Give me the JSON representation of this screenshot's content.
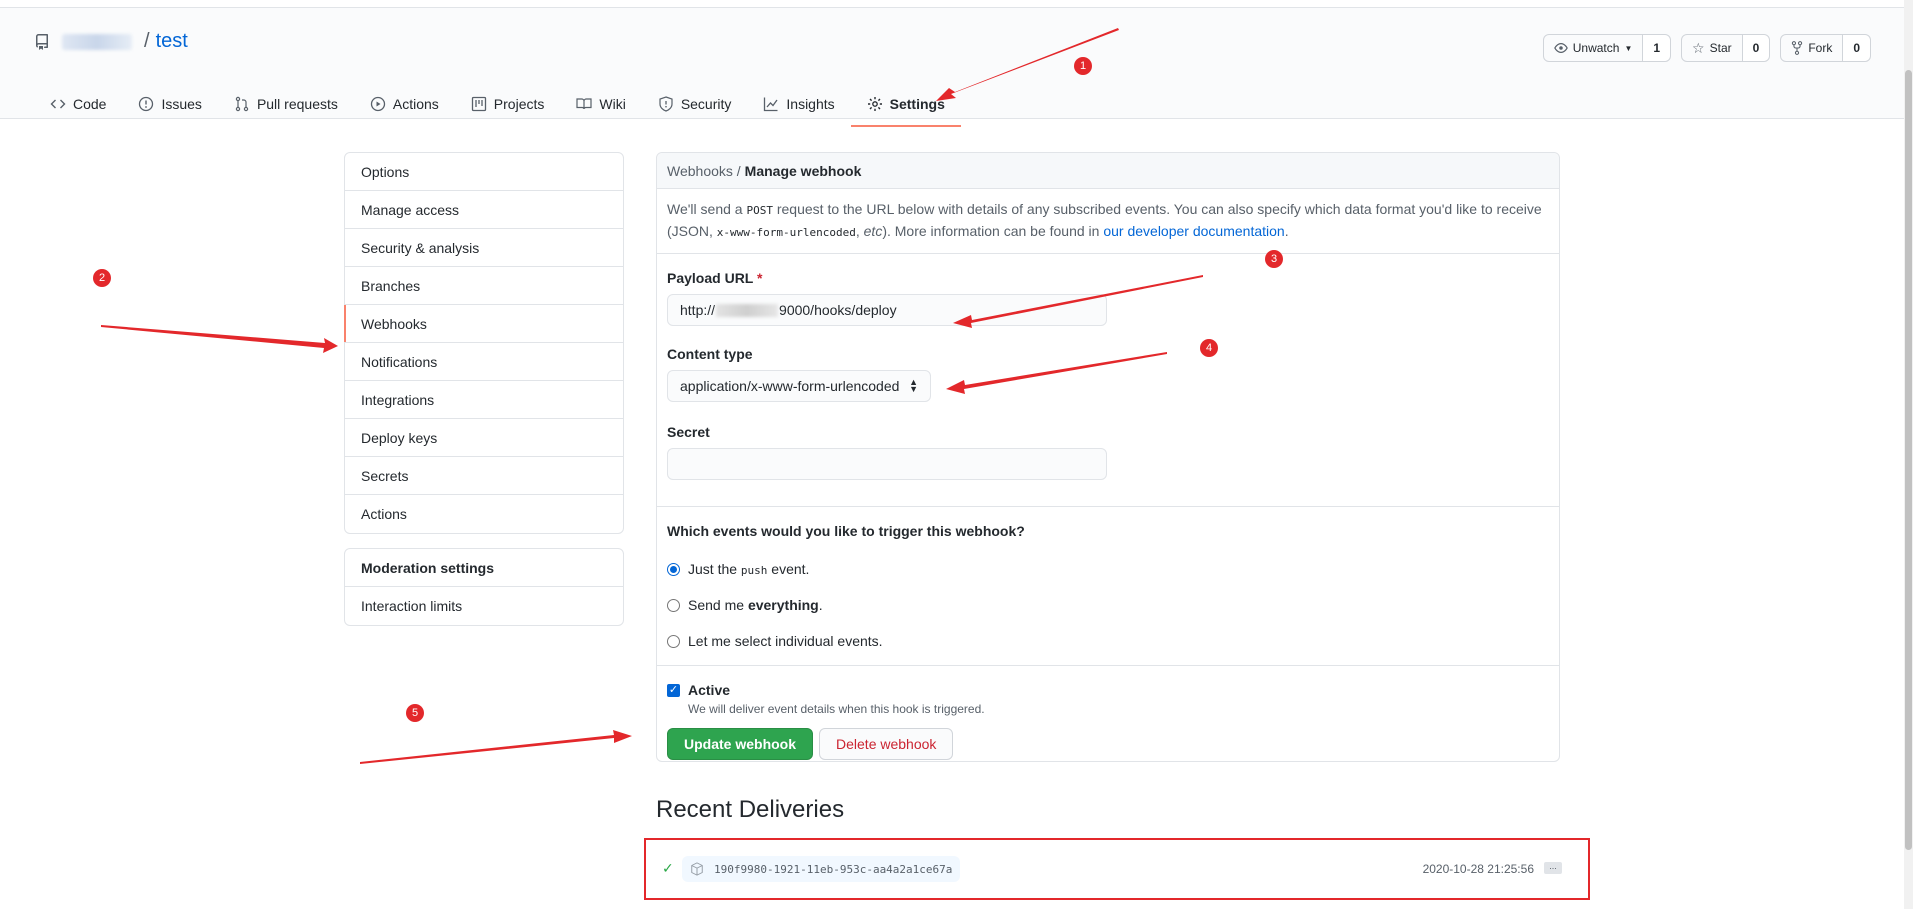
{
  "repo": {
    "name": "test",
    "separator": "/"
  },
  "gh_buttons": [
    {
      "label": "Unwatch",
      "count": "1"
    },
    {
      "label": "Star",
      "count": "0"
    },
    {
      "label": "Fork",
      "count": "0"
    }
  ],
  "tabs": [
    "Code",
    "Issues",
    "Pull requests",
    "Actions",
    "Projects",
    "Wiki",
    "Security",
    "Insights",
    "Settings"
  ],
  "sidebar": {
    "items": [
      "Options",
      "Manage access",
      "Security & analysis",
      "Branches",
      "Webhooks",
      "Notifications",
      "Integrations",
      "Deploy keys",
      "Secrets",
      "Actions"
    ],
    "moderation_head": "Moderation settings",
    "moderation_items": [
      "Interaction limits"
    ]
  },
  "panel": {
    "crumb": "Webhooks /",
    "title": "Manage webhook",
    "intro_1": "We'll send a ",
    "intro_post": "POST",
    "intro_2": " request to the URL below with details of any subscribed events. You can also specify which data format you'd like to receive (JSON, ",
    "intro_code": "x-www-form-urlencoded",
    "intro_3": ", ",
    "intro_etc": "etc",
    "intro_4": "). More information can be found in ",
    "intro_link": "our developer documentation",
    "intro_5": ".",
    "payload_label": "Payload URL",
    "payload_req": "*",
    "payload_prefix": "http://",
    "payload_suffix": "9000/hooks/deploy",
    "content_label": "Content type",
    "content_value": "application/x-www-form-urlencoded",
    "secret_label": "Secret",
    "events_question": "Which events would you like to trigger this webhook?",
    "events": {
      "just_a": "Just the ",
      "just_code": "push",
      "just_b": " event.",
      "send_a": "Send me ",
      "send_b": "everything",
      "send_c": ".",
      "let": "Let me select individual events."
    },
    "active_label": "Active",
    "active_note": "We will deliver event details when this hook is triggered.",
    "update_btn": "Update webhook",
    "delete_btn": "Delete webhook"
  },
  "recent": {
    "title": "Recent Deliveries",
    "guid": "190f9980-1921-11eb-953c-aa4a2a1ce67a",
    "time": "2020-10-28 21:25:56",
    "more": "..."
  },
  "annotations": [
    "1",
    "2",
    "3",
    "4",
    "5"
  ],
  "colors": {
    "accent": "#0366d6",
    "annotation": "#e3282b",
    "green": "#2ea44f",
    "tab_underline": "#f9826c"
  }
}
